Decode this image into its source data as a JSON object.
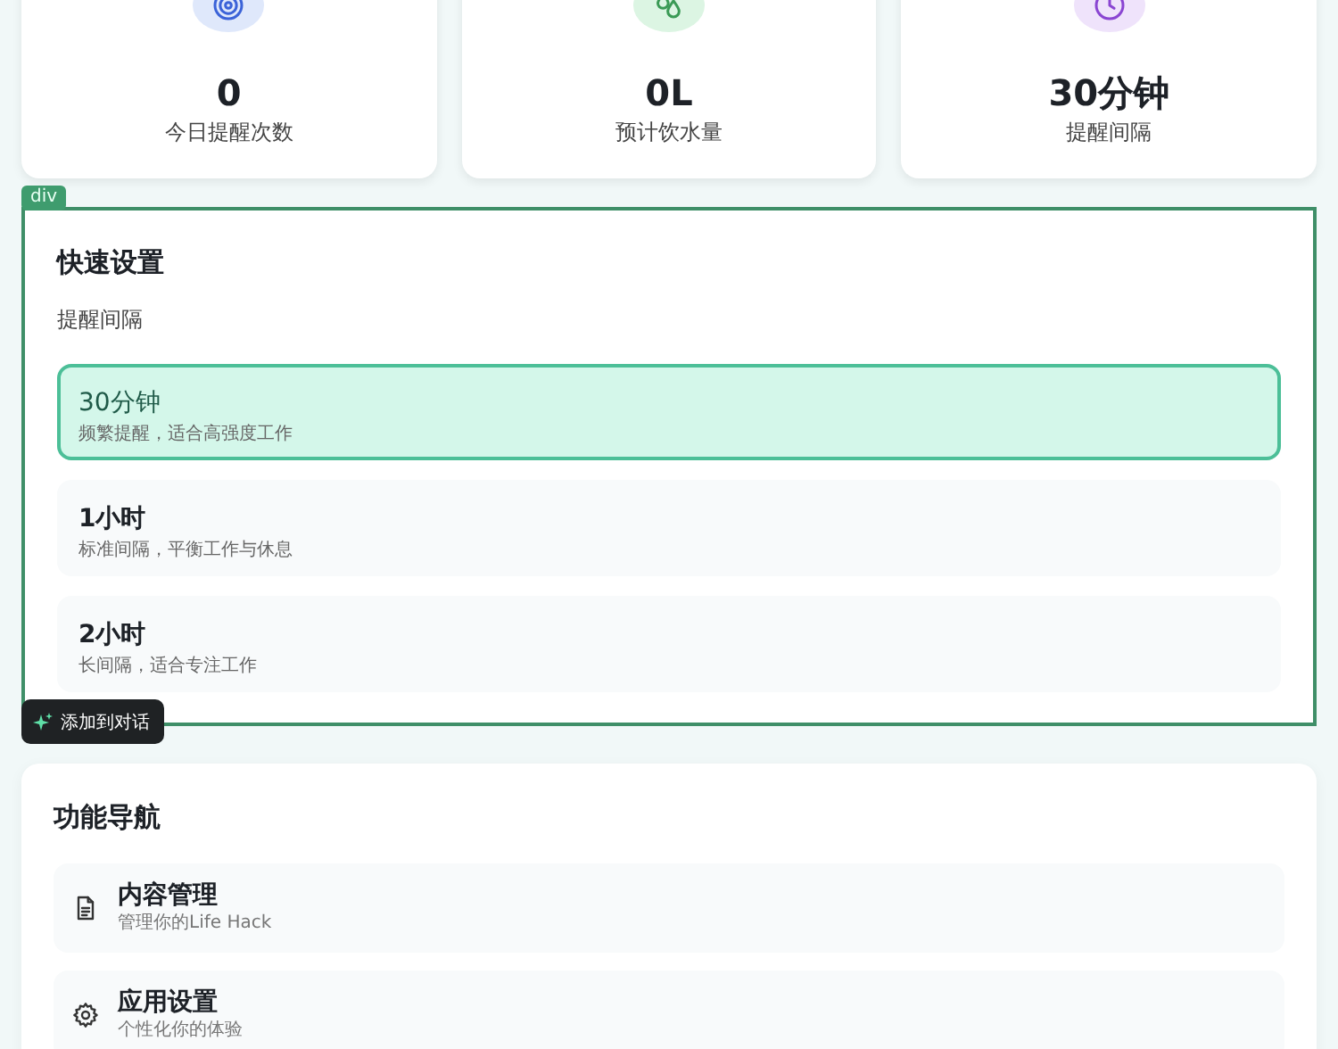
{
  "stats": [
    {
      "kind": "target",
      "value": "0",
      "label": "今日提醒次数"
    },
    {
      "kind": "drops",
      "value": "0L",
      "label": "预计饮水量"
    },
    {
      "kind": "clock",
      "value": "30分钟",
      "label": "提醒间隔"
    }
  ],
  "inspector_tag": "div",
  "quick_settings": {
    "title": "快速设置",
    "label": "提醒间隔",
    "options": [
      {
        "title": "30分钟",
        "description": "频繁提醒，适合高强度工作",
        "selected": true
      },
      {
        "title": "1小时",
        "description": "标准间隔，平衡工作与休息",
        "selected": false
      },
      {
        "title": "2小时",
        "description": "长间隔，适合专注工作",
        "selected": false
      }
    ]
  },
  "add_to_chat_button": "添加到对话",
  "navigation": {
    "title": "功能导航",
    "items": [
      {
        "kind": "document",
        "title": "内容管理",
        "description": "管理你的Life Hack"
      },
      {
        "kind": "gear",
        "title": "应用设置",
        "description": "个性化你的体验"
      }
    ]
  }
}
